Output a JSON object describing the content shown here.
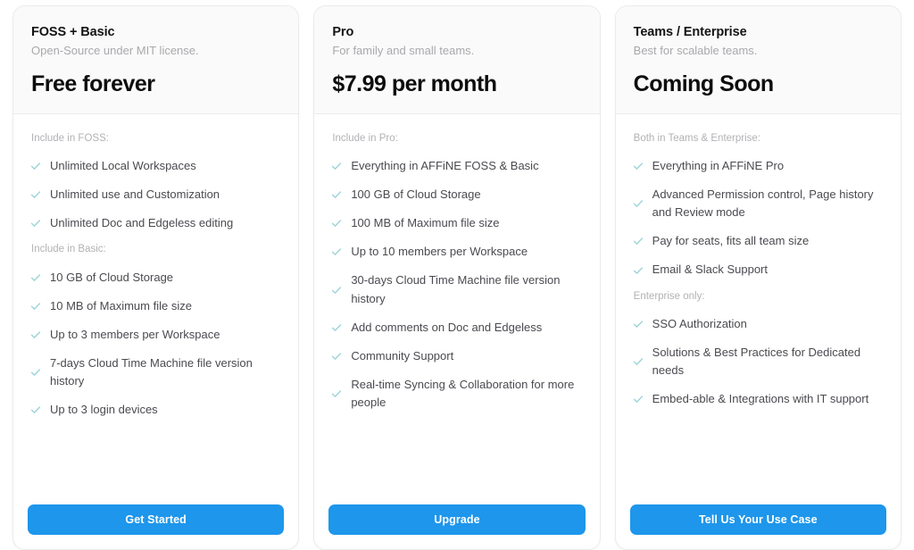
{
  "theme": {
    "accent": "#1e96eb",
    "check_color": "#9fd5d8",
    "card_border": "#ebebeb",
    "header_bg": "#fafafa",
    "page_bg": "#ffffff",
    "text_primary": "#141414",
    "text_body": "#4a4a50",
    "text_muted": "#a9a9ad"
  },
  "plans": [
    {
      "name": "FOSS + Basic",
      "tagline": "Open-Source under MIT license.",
      "price": "Free forever",
      "cta": "Get Started",
      "groups": [
        {
          "label": "Include in FOSS:",
          "features": [
            "Unlimited Local Workspaces",
            "Unlimited use and Customization",
            "Unlimited Doc and Edgeless editing"
          ]
        },
        {
          "label": "Include in Basic:",
          "features": [
            "10 GB of Cloud Storage",
            "10 MB of Maximum file size",
            "Up to 3 members per Workspace",
            "7-days Cloud Time Machine file version history",
            "Up to 3 login devices"
          ]
        }
      ]
    },
    {
      "name": "Pro",
      "tagline": "For family and small teams.",
      "price": "$7.99 per month",
      "cta": "Upgrade",
      "groups": [
        {
          "label": "Include in Pro:",
          "features": [
            "Everything in AFFiNE FOSS & Basic",
            "100 GB of Cloud Storage",
            "100 MB of Maximum file size",
            "Up to 10 members per Workspace",
            "30-days Cloud Time Machine file version history",
            "Add comments on Doc and Edgeless",
            "Community Support",
            "Real-time Syncing & Collaboration for more people"
          ]
        }
      ]
    },
    {
      "name": "Teams / Enterprise",
      "tagline": "Best for scalable teams.",
      "price": "Coming Soon",
      "cta": "Tell Us Your Use Case",
      "groups": [
        {
          "label": "Both in Teams & Enterprise:",
          "features": [
            "Everything in AFFiNE Pro",
            "Advanced Permission control, Page history and Review mode",
            "Pay for seats, fits all team size",
            "Email & Slack Support"
          ]
        },
        {
          "label": "Enterprise only:",
          "features": [
            "SSO Authorization",
            "Solutions & Best Practices for Dedicated needs",
            "Embed-able & Integrations with IT support"
          ]
        }
      ]
    }
  ]
}
